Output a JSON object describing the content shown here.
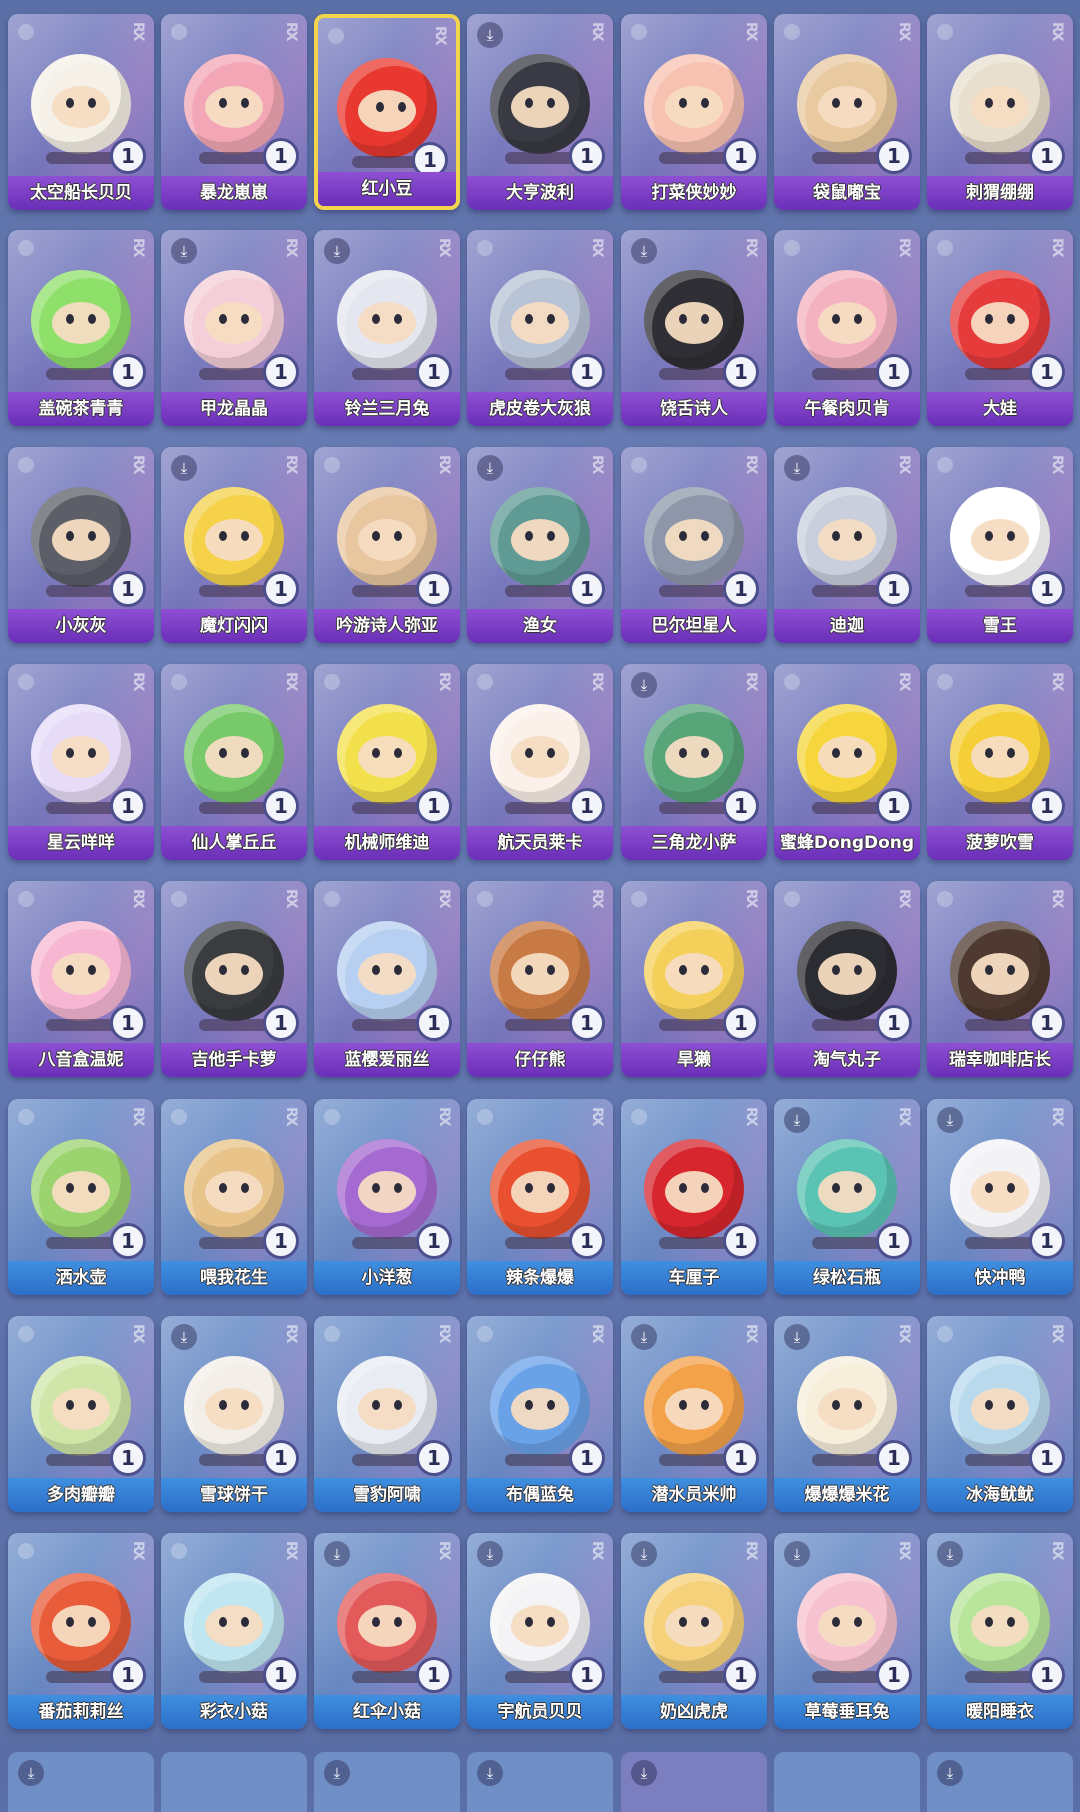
{
  "count_label": "1",
  "colors": {
    "purple_label": "#7b3fc8",
    "blue_label": "#3a83d8",
    "selected_border": "#f2d44d"
  },
  "icons": {
    "download": "download-icon",
    "brand": "brand-logo-icon"
  },
  "rows": [
    {
      "theme": "purple",
      "items": [
        {
          "name": "太空船长贝贝",
          "dl": false,
          "color": "#f5f1e8"
        },
        {
          "name": "暴龙崽崽",
          "dl": false,
          "color": "#f3a7b6"
        },
        {
          "name": "红小豆",
          "dl": false,
          "color": "#e8382f",
          "selected": true
        },
        {
          "name": "大亨波利",
          "dl": true,
          "color": "#3a3a44"
        },
        {
          "name": "打菜侠妙妙",
          "dl": false,
          "color": "#f7c2b2"
        },
        {
          "name": "袋鼠嘟宝",
          "dl": false,
          "color": "#e8c9a0"
        },
        {
          "name": "刺猬绷绷",
          "dl": false,
          "color": "#e9dfcf"
        }
      ]
    },
    {
      "theme": "purple",
      "items": [
        {
          "name": "盖碗茶青青",
          "dl": false,
          "color": "#8fe06a"
        },
        {
          "name": "甲龙晶晶",
          "dl": true,
          "color": "#f4cfd9"
        },
        {
          "name": "铃兰三月兔",
          "dl": true,
          "color": "#e4e7ef"
        },
        {
          "name": "虎皮卷大灰狼",
          "dl": false,
          "color": "#b9c3d6"
        },
        {
          "name": "饶舌诗人",
          "dl": true,
          "color": "#2f2f35"
        },
        {
          "name": "午餐肉贝肯",
          "dl": false,
          "color": "#f4b2c0"
        },
        {
          "name": "大娃",
          "dl": false,
          "color": "#e63b3b"
        }
      ]
    },
    {
      "theme": "purple",
      "items": [
        {
          "name": "小灰灰",
          "dl": false,
          "color": "#5c5f68"
        },
        {
          "name": "魔灯闪闪",
          "dl": true,
          "color": "#f5d24a"
        },
        {
          "name": "吟游诗人弥亚",
          "dl": false,
          "color": "#e8c7a0"
        },
        {
          "name": "渔女",
          "dl": true,
          "color": "#5f9a94"
        },
        {
          "name": "巴尔坦星人",
          "dl": false,
          "color": "#8e97aa"
        },
        {
          "name": "迪迦",
          "dl": true,
          "color": "#c9cfdc"
        },
        {
          "name": "雪王",
          "dl": false,
          "color": "#ffffff"
        }
      ]
    },
    {
      "theme": "purple",
      "items": [
        {
          "name": "星云咩咩",
          "dl": false,
          "color": "#e7dcf8"
        },
        {
          "name": "仙人掌丘丘",
          "dl": false,
          "color": "#78c96a"
        },
        {
          "name": "机械师维迪",
          "dl": false,
          "color": "#f3e04d"
        },
        {
          "name": "航天员莱卡",
          "dl": false,
          "color": "#fbf1ea"
        },
        {
          "name": "三角龙小萨",
          "dl": true,
          "color": "#58a57a"
        },
        {
          "name": "蜜蜂DongDong",
          "dl": false,
          "color": "#f6d63c"
        },
        {
          "name": "菠萝吹雪",
          "dl": false,
          "color": "#f5cf38"
        }
      ]
    },
    {
      "theme": "purple",
      "items": [
        {
          "name": "八音盒温妮",
          "dl": false,
          "color": "#f7b7d3"
        },
        {
          "name": "吉他手卡萝",
          "dl": false,
          "color": "#3a3c40"
        },
        {
          "name": "蓝樱爱丽丝",
          "dl": false,
          "color": "#b7d0f1"
        },
        {
          "name": "仔仔熊",
          "dl": false,
          "color": "#c87a44"
        },
        {
          "name": "旱獭",
          "dl": false,
          "color": "#f4d05a"
        },
        {
          "name": "淘气丸子",
          "dl": false,
          "color": "#2c2c33"
        },
        {
          "name": "瑞幸咖啡店长",
          "dl": false,
          "color": "#4e3a30"
        }
      ]
    },
    {
      "theme": "blue",
      "items": [
        {
          "name": "洒水壶",
          "dl": false,
          "color": "#9bd36f"
        },
        {
          "name": "喂我花生",
          "dl": false,
          "color": "#e8c48a"
        },
        {
          "name": "小洋葱",
          "dl": false,
          "color": "#a56ad1"
        },
        {
          "name": "辣条爆爆",
          "dl": false,
          "color": "#e9502f"
        },
        {
          "name": "车厘子",
          "dl": false,
          "color": "#d7262e"
        },
        {
          "name": "绿松石瓶",
          "dl": true,
          "color": "#5bc3b3"
        },
        {
          "name": "快冲鸭",
          "dl": true,
          "color": "#f3f3f6"
        }
      ]
    },
    {
      "theme": "blue",
      "items": [
        {
          "name": "多肉瓣瓣",
          "dl": false,
          "color": "#cfe6a8"
        },
        {
          "name": "雪球饼干",
          "dl": true,
          "color": "#f3eee8"
        },
        {
          "name": "雪豹阿啸",
          "dl": false,
          "color": "#e9ecf2"
        },
        {
          "name": "布偶蓝兔",
          "dl": false,
          "color": "#6aa2e8"
        },
        {
          "name": "潜水员米帅",
          "dl": true,
          "color": "#f3a24a"
        },
        {
          "name": "爆爆爆米花",
          "dl": true,
          "color": "#f7efdc"
        },
        {
          "name": "冰海鱿鱿",
          "dl": false,
          "color": "#b9d9ec"
        }
      ]
    },
    {
      "theme": "blue",
      "items": [
        {
          "name": "番茄莉莉丝",
          "dl": false,
          "color": "#e85c3a"
        },
        {
          "name": "彩衣小菇",
          "dl": false,
          "color": "#bfe6f1"
        },
        {
          "name": "红伞小菇",
          "dl": true,
          "color": "#e35a5a"
        },
        {
          "name": "宇航员贝贝",
          "dl": true,
          "color": "#f4f4f6"
        },
        {
          "name": "奶凶虎虎",
          "dl": true,
          "color": "#f4d17a"
        },
        {
          "name": "草莓垂耳兔",
          "dl": true,
          "color": "#f6c2cf"
        },
        {
          "name": "暖阳睡衣",
          "dl": true,
          "color": "#b8e59a"
        }
      ]
    }
  ]
}
